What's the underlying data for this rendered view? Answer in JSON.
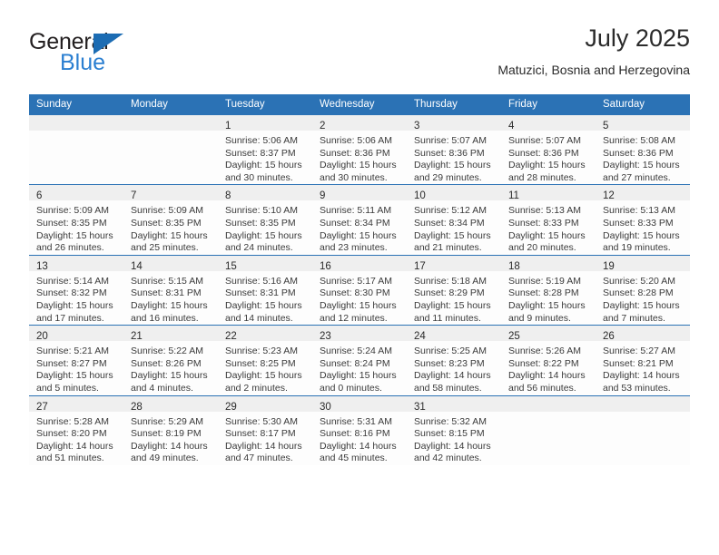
{
  "brand": {
    "name_part1": "General",
    "name_part2": "Blue",
    "accent_color": "#2b7fd1",
    "triangle_color": "#1c6cb3",
    "logo_icon": "triangle-icon"
  },
  "header": {
    "title": "July 2025",
    "subtitle": "Matuzici, Bosnia and Herzegovina"
  },
  "calendar": {
    "header_bg": "#2b72b5",
    "daynum_band_bg": "#efefef",
    "weekday_headers": [
      "Sunday",
      "Monday",
      "Tuesday",
      "Wednesday",
      "Thursday",
      "Friday",
      "Saturday"
    ],
    "weeks": [
      [
        {
          "day": "",
          "sunrise": "",
          "sunset": "",
          "daylight_line1": "",
          "daylight_line2": ""
        },
        {
          "day": "",
          "sunrise": "",
          "sunset": "",
          "daylight_line1": "",
          "daylight_line2": ""
        },
        {
          "day": "1",
          "sunrise": "Sunrise: 5:06 AM",
          "sunset": "Sunset: 8:37 PM",
          "daylight_line1": "Daylight: 15 hours",
          "daylight_line2": "and 30 minutes."
        },
        {
          "day": "2",
          "sunrise": "Sunrise: 5:06 AM",
          "sunset": "Sunset: 8:36 PM",
          "daylight_line1": "Daylight: 15 hours",
          "daylight_line2": "and 30 minutes."
        },
        {
          "day": "3",
          "sunrise": "Sunrise: 5:07 AM",
          "sunset": "Sunset: 8:36 PM",
          "daylight_line1": "Daylight: 15 hours",
          "daylight_line2": "and 29 minutes."
        },
        {
          "day": "4",
          "sunrise": "Sunrise: 5:07 AM",
          "sunset": "Sunset: 8:36 PM",
          "daylight_line1": "Daylight: 15 hours",
          "daylight_line2": "and 28 minutes."
        },
        {
          "day": "5",
          "sunrise": "Sunrise: 5:08 AM",
          "sunset": "Sunset: 8:36 PM",
          "daylight_line1": "Daylight: 15 hours",
          "daylight_line2": "and 27 minutes."
        }
      ],
      [
        {
          "day": "6",
          "sunrise": "Sunrise: 5:09 AM",
          "sunset": "Sunset: 8:35 PM",
          "daylight_line1": "Daylight: 15 hours",
          "daylight_line2": "and 26 minutes."
        },
        {
          "day": "7",
          "sunrise": "Sunrise: 5:09 AM",
          "sunset": "Sunset: 8:35 PM",
          "daylight_line1": "Daylight: 15 hours",
          "daylight_line2": "and 25 minutes."
        },
        {
          "day": "8",
          "sunrise": "Sunrise: 5:10 AM",
          "sunset": "Sunset: 8:35 PM",
          "daylight_line1": "Daylight: 15 hours",
          "daylight_line2": "and 24 minutes."
        },
        {
          "day": "9",
          "sunrise": "Sunrise: 5:11 AM",
          "sunset": "Sunset: 8:34 PM",
          "daylight_line1": "Daylight: 15 hours",
          "daylight_line2": "and 23 minutes."
        },
        {
          "day": "10",
          "sunrise": "Sunrise: 5:12 AM",
          "sunset": "Sunset: 8:34 PM",
          "daylight_line1": "Daylight: 15 hours",
          "daylight_line2": "and 21 minutes."
        },
        {
          "day": "11",
          "sunrise": "Sunrise: 5:13 AM",
          "sunset": "Sunset: 8:33 PM",
          "daylight_line1": "Daylight: 15 hours",
          "daylight_line2": "and 20 minutes."
        },
        {
          "day": "12",
          "sunrise": "Sunrise: 5:13 AM",
          "sunset": "Sunset: 8:33 PM",
          "daylight_line1": "Daylight: 15 hours",
          "daylight_line2": "and 19 minutes."
        }
      ],
      [
        {
          "day": "13",
          "sunrise": "Sunrise: 5:14 AM",
          "sunset": "Sunset: 8:32 PM",
          "daylight_line1": "Daylight: 15 hours",
          "daylight_line2": "and 17 minutes."
        },
        {
          "day": "14",
          "sunrise": "Sunrise: 5:15 AM",
          "sunset": "Sunset: 8:31 PM",
          "daylight_line1": "Daylight: 15 hours",
          "daylight_line2": "and 16 minutes."
        },
        {
          "day": "15",
          "sunrise": "Sunrise: 5:16 AM",
          "sunset": "Sunset: 8:31 PM",
          "daylight_line1": "Daylight: 15 hours",
          "daylight_line2": "and 14 minutes."
        },
        {
          "day": "16",
          "sunrise": "Sunrise: 5:17 AM",
          "sunset": "Sunset: 8:30 PM",
          "daylight_line1": "Daylight: 15 hours",
          "daylight_line2": "and 12 minutes."
        },
        {
          "day": "17",
          "sunrise": "Sunrise: 5:18 AM",
          "sunset": "Sunset: 8:29 PM",
          "daylight_line1": "Daylight: 15 hours",
          "daylight_line2": "and 11 minutes."
        },
        {
          "day": "18",
          "sunrise": "Sunrise: 5:19 AM",
          "sunset": "Sunset: 8:28 PM",
          "daylight_line1": "Daylight: 15 hours",
          "daylight_line2": "and 9 minutes."
        },
        {
          "day": "19",
          "sunrise": "Sunrise: 5:20 AM",
          "sunset": "Sunset: 8:28 PM",
          "daylight_line1": "Daylight: 15 hours",
          "daylight_line2": "and 7 minutes."
        }
      ],
      [
        {
          "day": "20",
          "sunrise": "Sunrise: 5:21 AM",
          "sunset": "Sunset: 8:27 PM",
          "daylight_line1": "Daylight: 15 hours",
          "daylight_line2": "and 5 minutes."
        },
        {
          "day": "21",
          "sunrise": "Sunrise: 5:22 AM",
          "sunset": "Sunset: 8:26 PM",
          "daylight_line1": "Daylight: 15 hours",
          "daylight_line2": "and 4 minutes."
        },
        {
          "day": "22",
          "sunrise": "Sunrise: 5:23 AM",
          "sunset": "Sunset: 8:25 PM",
          "daylight_line1": "Daylight: 15 hours",
          "daylight_line2": "and 2 minutes."
        },
        {
          "day": "23",
          "sunrise": "Sunrise: 5:24 AM",
          "sunset": "Sunset: 8:24 PM",
          "daylight_line1": "Daylight: 15 hours",
          "daylight_line2": "and 0 minutes."
        },
        {
          "day": "24",
          "sunrise": "Sunrise: 5:25 AM",
          "sunset": "Sunset: 8:23 PM",
          "daylight_line1": "Daylight: 14 hours",
          "daylight_line2": "and 58 minutes."
        },
        {
          "day": "25",
          "sunrise": "Sunrise: 5:26 AM",
          "sunset": "Sunset: 8:22 PM",
          "daylight_line1": "Daylight: 14 hours",
          "daylight_line2": "and 56 minutes."
        },
        {
          "day": "26",
          "sunrise": "Sunrise: 5:27 AM",
          "sunset": "Sunset: 8:21 PM",
          "daylight_line1": "Daylight: 14 hours",
          "daylight_line2": "and 53 minutes."
        }
      ],
      [
        {
          "day": "27",
          "sunrise": "Sunrise: 5:28 AM",
          "sunset": "Sunset: 8:20 PM",
          "daylight_line1": "Daylight: 14 hours",
          "daylight_line2": "and 51 minutes."
        },
        {
          "day": "28",
          "sunrise": "Sunrise: 5:29 AM",
          "sunset": "Sunset: 8:19 PM",
          "daylight_line1": "Daylight: 14 hours",
          "daylight_line2": "and 49 minutes."
        },
        {
          "day": "29",
          "sunrise": "Sunrise: 5:30 AM",
          "sunset": "Sunset: 8:17 PM",
          "daylight_line1": "Daylight: 14 hours",
          "daylight_line2": "and 47 minutes."
        },
        {
          "day": "30",
          "sunrise": "Sunrise: 5:31 AM",
          "sunset": "Sunset: 8:16 PM",
          "daylight_line1": "Daylight: 14 hours",
          "daylight_line2": "and 45 minutes."
        },
        {
          "day": "31",
          "sunrise": "Sunrise: 5:32 AM",
          "sunset": "Sunset: 8:15 PM",
          "daylight_line1": "Daylight: 14 hours",
          "daylight_line2": "and 42 minutes."
        },
        {
          "day": "",
          "sunrise": "",
          "sunset": "",
          "daylight_line1": "",
          "daylight_line2": ""
        },
        {
          "day": "",
          "sunrise": "",
          "sunset": "",
          "daylight_line1": "",
          "daylight_line2": ""
        }
      ]
    ]
  }
}
